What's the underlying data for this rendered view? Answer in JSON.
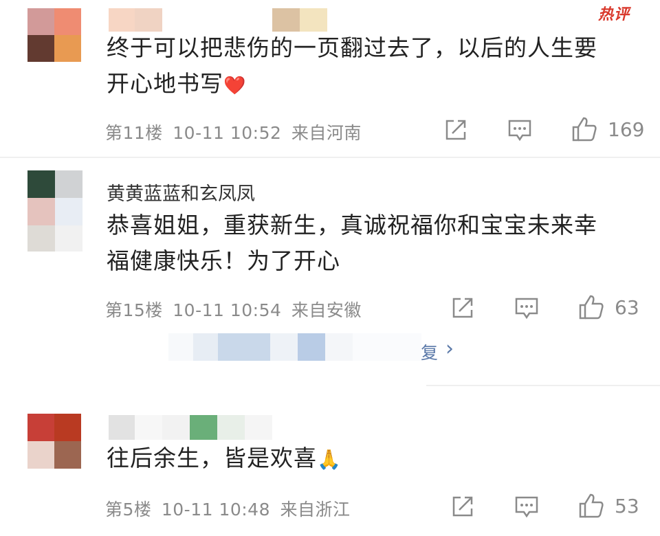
{
  "badge": {
    "hot": "热评"
  },
  "comments": [
    {
      "username": "",
      "text_line1": "终于可以把悲伤的一页翻过去了，以后的人生要",
      "text_line2": "开心地书写",
      "emoji": "❤️",
      "floor": "第11楼",
      "datetime": "10-11 10:52",
      "location": "来自河南",
      "likes": "169"
    },
    {
      "username": "黄黄蓝蓝和玄凤凤",
      "text_line1": "恭喜姐姐，重获新生，真诚祝福你和宝宝未来幸",
      "text_line2": "福健康快乐！为了开心",
      "floor": "第15楼",
      "datetime": "10-11 10:54",
      "location": "来自安徽",
      "likes": "63"
    },
    {
      "username": "",
      "text_line1": "往后余生，皆是欢喜",
      "emoji": "🙏",
      "floor": "第5楼",
      "datetime": "10-11 10:48",
      "location": "来自浙江",
      "likes": "53"
    }
  ],
  "replies": {
    "partial_label": "复",
    "arrow": "›"
  },
  "icons": {
    "share": "share-icon",
    "comment": "comment-icon",
    "like": "like-icon"
  },
  "colors": {
    "text": "#222222",
    "meta": "#8a8a8a",
    "hot": "#d9382b",
    "link": "#5a78a8"
  }
}
